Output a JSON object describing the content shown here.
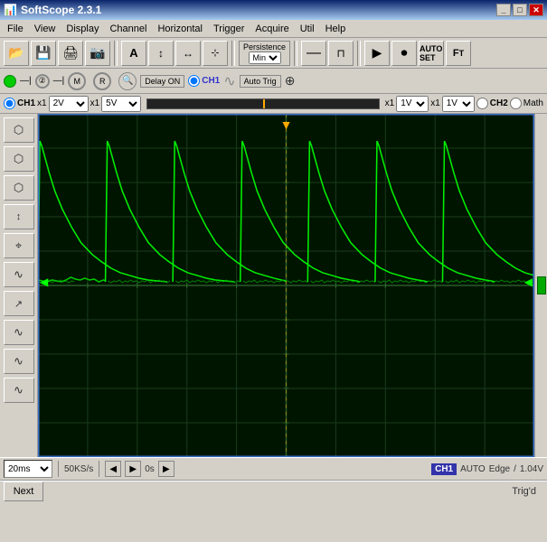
{
  "window": {
    "title": "SoftScope 2.3.1",
    "icon": "scope-icon"
  },
  "title_buttons": [
    "minimize",
    "maximize",
    "close"
  ],
  "menu": {
    "items": [
      "File",
      "View",
      "Display",
      "Channel",
      "Horizontal",
      "Trigger",
      "Acquire",
      "Util",
      "Help"
    ]
  },
  "toolbar": {
    "buttons": [
      "open-icon",
      "save-icon",
      "print-icon",
      "screenshot-icon",
      "text-icon",
      "cursor-v-icon",
      "cursor-h-icon",
      "cursor-icon",
      "persistence-icon",
      "triangle-icon",
      "square-icon",
      "play-icon",
      "record-icon",
      "autoset-icon",
      "fft-icon"
    ],
    "persistence": {
      "label": "Persistence",
      "value": "Min"
    }
  },
  "channel_bar": {
    "ch1_label": "CH1",
    "ch2_label": "CH2",
    "math_label": "Math",
    "x1_label": "x1",
    "volt_div": "2V",
    "volt_div2": "5V",
    "delay": "Delay ON",
    "ch1_active": "CH1",
    "auto_trig": "Auto Trig"
  },
  "scope": {
    "grid_color": "#1a3a1a",
    "trace_color": "#00ff00",
    "background": "#001a00",
    "border_color": "#3a6fc4",
    "trigger_pos": "center"
  },
  "left_sidebar": {
    "buttons": [
      "cursor-v",
      "cursor-h",
      "cursor-t",
      "zoom-in",
      "zoom-out",
      "pan",
      "measure-v",
      "measure-h",
      "math-add",
      "math-sub",
      "math-fft",
      "ref-show"
    ]
  },
  "status_bar": {
    "time_div": "20ms",
    "sample_rate": "50KS/s",
    "time_offset": "0s",
    "ch_mode": "CH1",
    "trigger_mode": "AUTO",
    "trigger_type": "Edge",
    "trigger_slope": "/",
    "trigger_level": "1.04V"
  },
  "bottom_status": {
    "next_button": "Next",
    "trig_status": "Trig'd"
  }
}
